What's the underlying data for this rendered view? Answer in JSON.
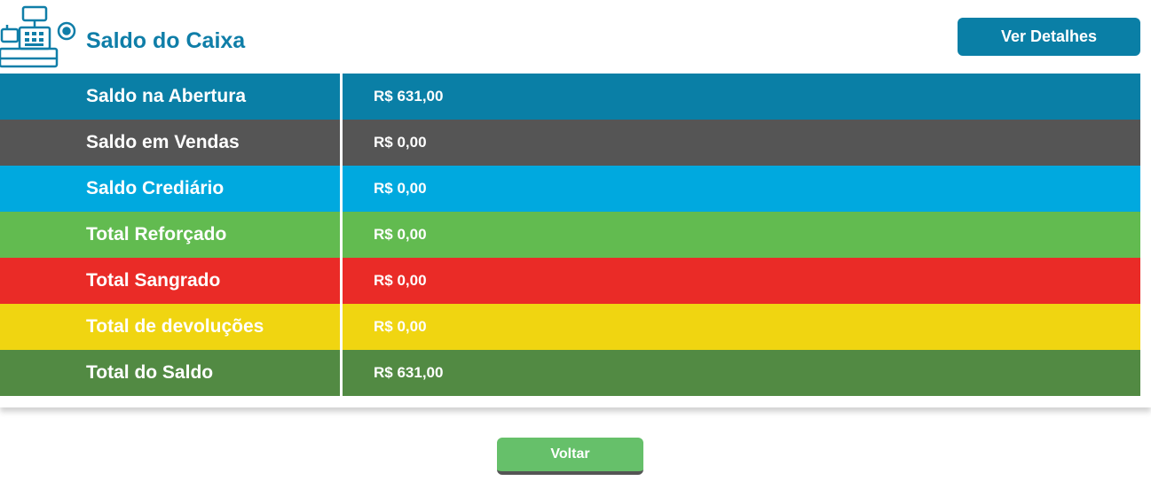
{
  "header": {
    "icon": "cash-register-icon",
    "title": "Saldo do Caixa",
    "details_button": "Ver Detalhes"
  },
  "rows": [
    {
      "label": "Saldo na Abertura",
      "value": "R$ 631,00",
      "color": "#0a7fa6"
    },
    {
      "label": "Saldo em Vendas",
      "value": "R$ 0,00",
      "color": "#555555"
    },
    {
      "label": "Saldo Crediário",
      "value": "R$ 0,00",
      "color": "#00a9df"
    },
    {
      "label": "Total Reforçado",
      "value": "R$ 0,00",
      "color": "#62bb50"
    },
    {
      "label": "Total Sangrado",
      "value": "R$ 0,00",
      "color": "#ea2b27"
    },
    {
      "label": "Total de devoluções",
      "value": "R$ 0,00",
      "color": "#f0d511"
    },
    {
      "label": "Total do Saldo",
      "value": "R$ 631,00",
      "color": "#528a43"
    }
  ],
  "footer": {
    "back_button": "Voltar"
  }
}
